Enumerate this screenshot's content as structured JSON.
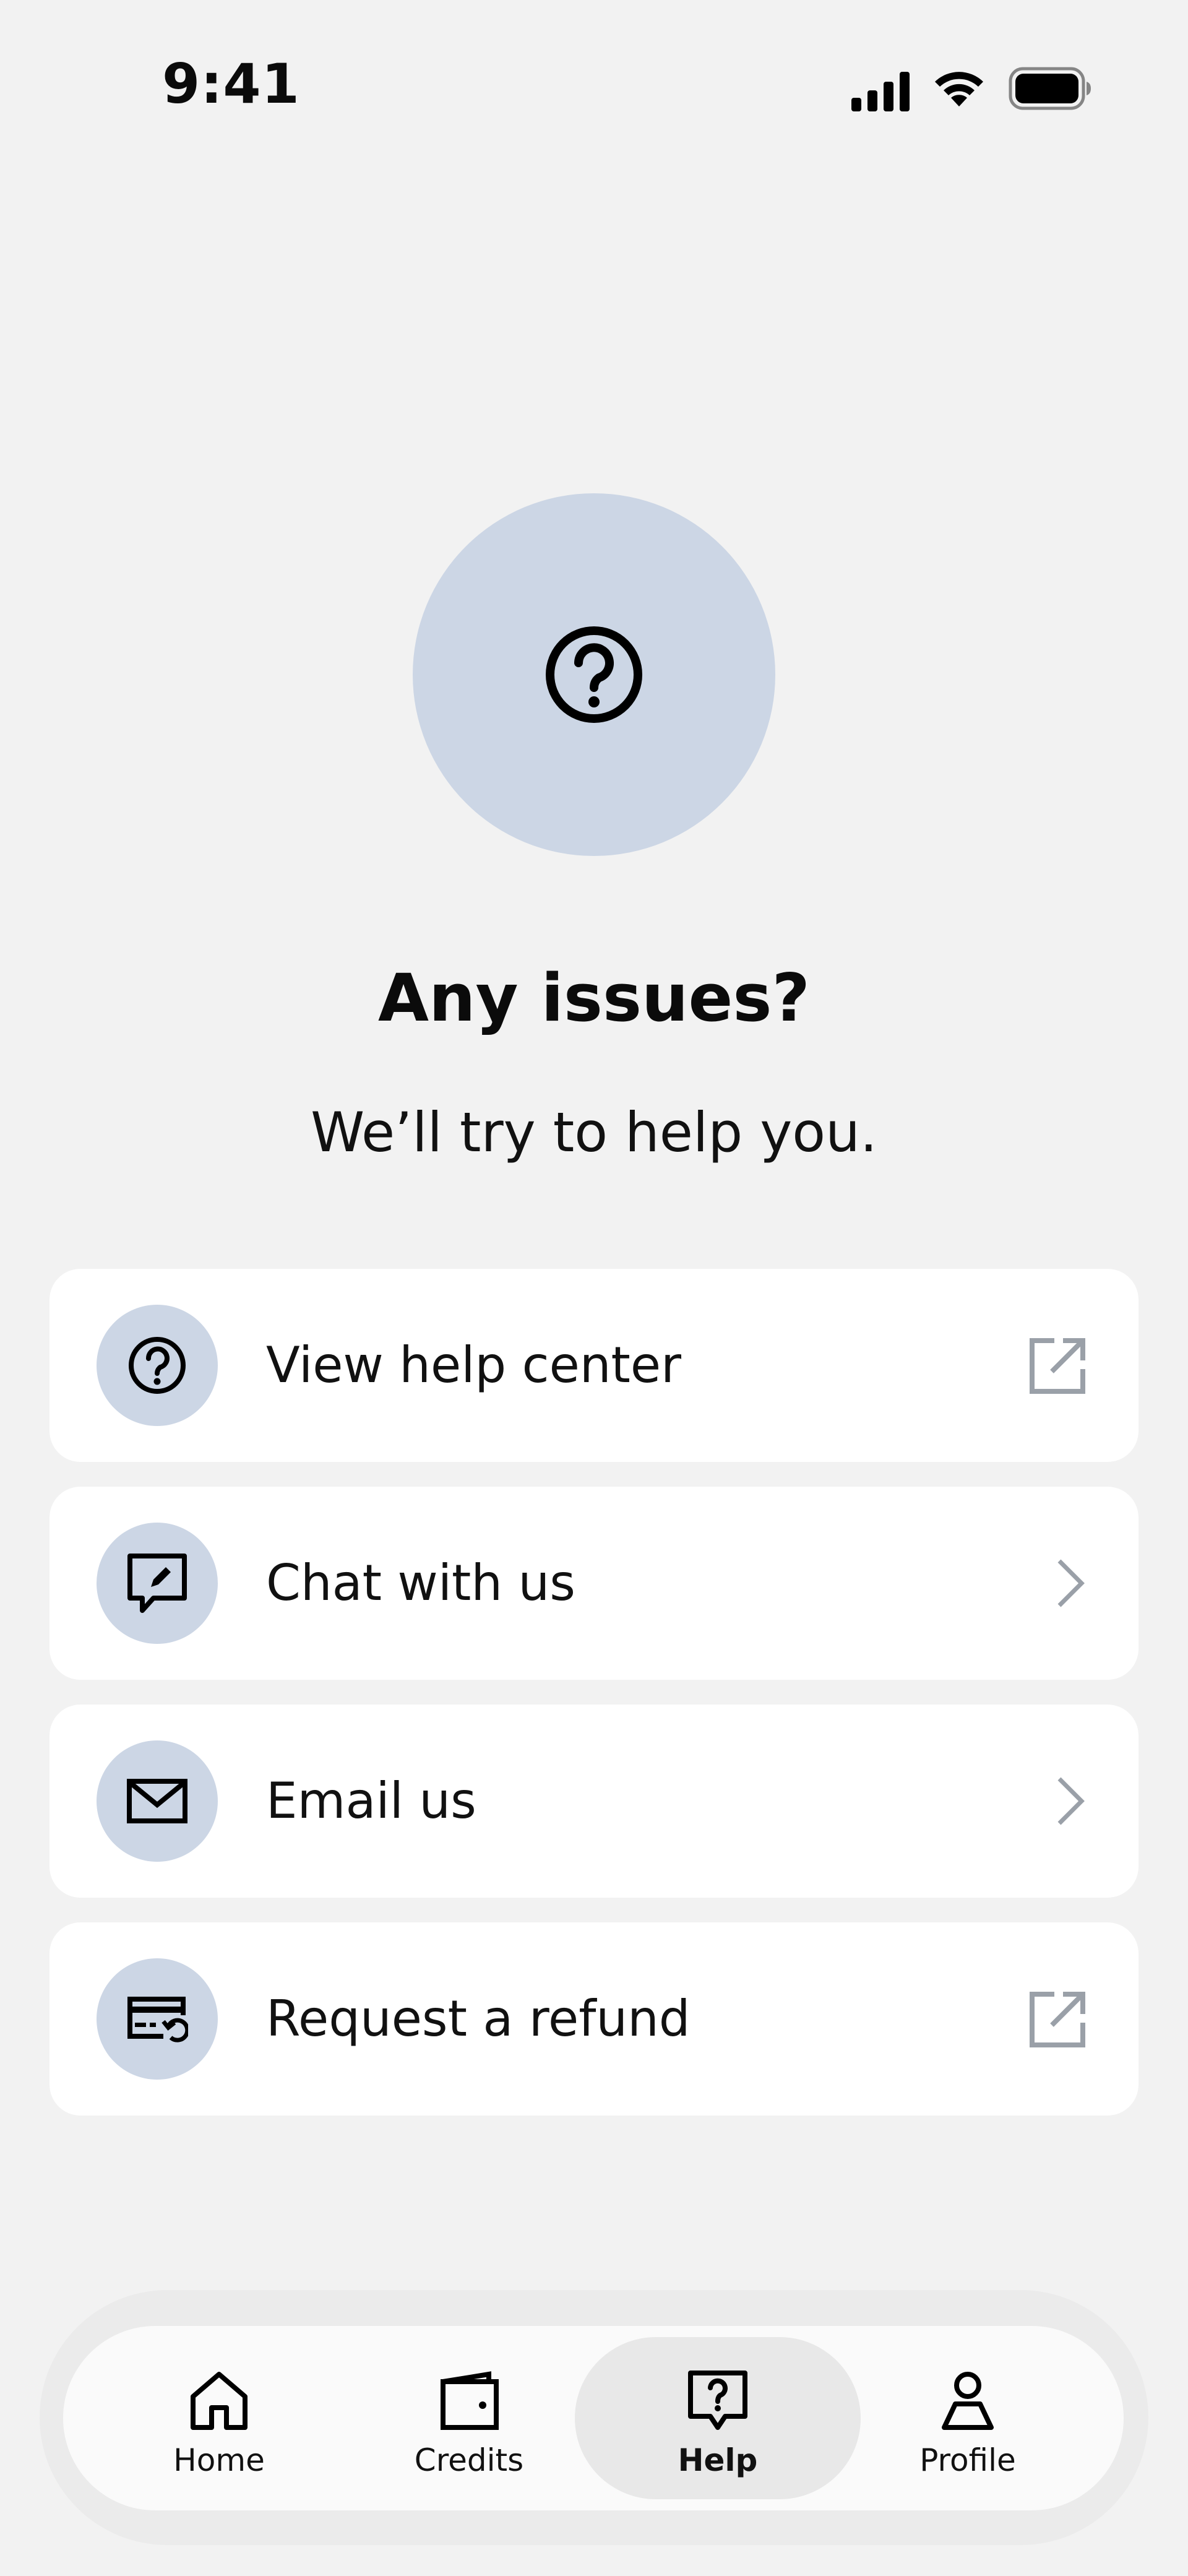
{
  "status_bar": {
    "time": "9:41"
  },
  "hero": {
    "icon": "question-circle-icon",
    "title": "Any issues?",
    "subtitle": "We’ll try to help you."
  },
  "options": [
    {
      "label": "View help center",
      "icon": "question-circle-icon",
      "trailing": "external-link-icon"
    },
    {
      "label": "Chat with us",
      "icon": "chat-edit-icon",
      "trailing": "chevron-right-icon"
    },
    {
      "label": "Email us",
      "icon": "mail-icon",
      "trailing": "chevron-right-icon"
    },
    {
      "label": "Request a refund",
      "icon": "refund-card-icon",
      "trailing": "external-link-icon"
    }
  ],
  "nav": {
    "items": [
      {
        "label": "Home",
        "icon": "home-icon"
      },
      {
        "label": "Credits",
        "icon": "wallet-icon"
      },
      {
        "label": "Help",
        "icon": "help-chat-icon",
        "active": true
      },
      {
        "label": "Profile",
        "icon": "person-icon"
      }
    ]
  },
  "colors": {
    "background": "#f2f2f2",
    "card": "#ffffff",
    "accent_circle": "#ccd6e5",
    "trailing_icon": "#9aa0a8",
    "nav_active": "#e8e8e8"
  }
}
